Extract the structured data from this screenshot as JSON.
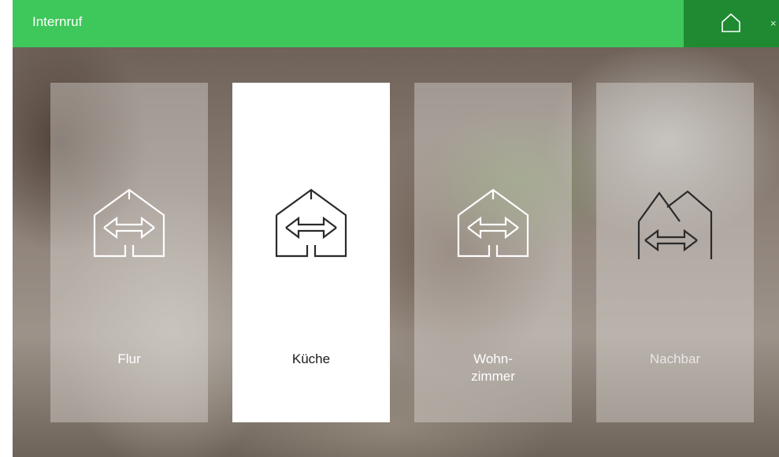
{
  "header": {
    "title": "Internruf",
    "home_icon": "home-icon",
    "close_glyph": "×"
  },
  "colors": {
    "header_green": "#3ec75a",
    "home_button_green": "#1f8a32"
  },
  "tiles": [
    {
      "label": "Flur",
      "icon": "house-intercom-icon",
      "selected": false
    },
    {
      "label": "Küche",
      "icon": "house-intercom-icon",
      "selected": true
    },
    {
      "label": "Wohn-\nzimmer",
      "icon": "house-intercom-icon",
      "selected": false
    },
    {
      "label": "Nachbar",
      "icon": "neighbor-houses-intercom-icon",
      "selected": false
    }
  ]
}
